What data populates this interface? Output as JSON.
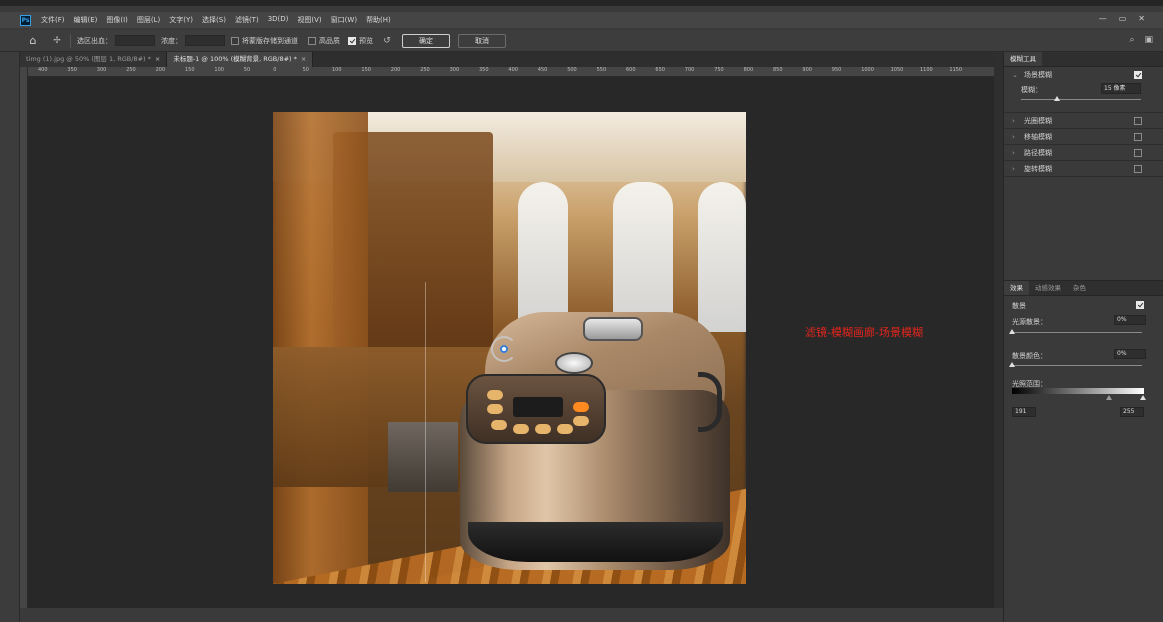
{
  "app": {
    "logo": "Ps"
  },
  "menu": [
    "文件(F)",
    "编辑(E)",
    "图像(I)",
    "图层(L)",
    "文字(Y)",
    "选择(S)",
    "滤镜(T)",
    "3D(D)",
    "视图(V)",
    "窗口(W)",
    "帮助(H)"
  ],
  "window_controls": {
    "minimize": "—",
    "restore": "▭",
    "close": "✕"
  },
  "options": {
    "selection_label": "选区出血：",
    "selection_value": "",
    "density_label": "浓度：",
    "density_value": "",
    "save_mask_label": "将蒙版存储到通道",
    "high_quality_label": "高品质",
    "preview_label": "预览",
    "ok_label": "确定",
    "cancel_label": "取消"
  },
  "tabs": [
    {
      "label": "timg (1).jpg @ 50% (图层 1, RGB/8#) *"
    },
    {
      "label": "未标题-1 @ 100% (模糊背景, RGB/8#) *"
    }
  ],
  "ruler_ticks": [
    "400",
    "350",
    "300",
    "250",
    "200",
    "150",
    "100",
    "50",
    "0",
    "50",
    "100",
    "150",
    "200",
    "250",
    "300",
    "350",
    "400",
    "450",
    "500",
    "550",
    "600",
    "650",
    "700",
    "750",
    "800",
    "850",
    "900",
    "950",
    "1000",
    "1050",
    "1100",
    "1150"
  ],
  "annotation": "滤镜-模糊画廊-场景模糊",
  "blur_tools": {
    "tab": "模糊工具",
    "field_blur": {
      "label": "场景模糊",
      "checked": true,
      "param_label": "模糊：",
      "param_value": "15 像素",
      "slider_fraction": 0.3
    },
    "sections": [
      {
        "label": "光圈模糊",
        "checked": false
      },
      {
        "label": "移轴模糊",
        "checked": false
      },
      {
        "label": "路径模糊",
        "checked": false
      },
      {
        "label": "旋转模糊",
        "checked": false
      }
    ]
  },
  "effects": {
    "tabs": [
      "效果",
      "动感效果",
      "杂色"
    ],
    "bokeh": {
      "label": "散景",
      "checked": true
    },
    "light_bokeh": {
      "label": "光源散景：",
      "value": "0%",
      "fraction": 0.0
    },
    "bokeh_color": {
      "label": "散景颜色：",
      "value": "0%",
      "fraction": 0.0
    },
    "light_range": {
      "label": "光照范围：",
      "low": "191",
      "high": "255"
    }
  }
}
